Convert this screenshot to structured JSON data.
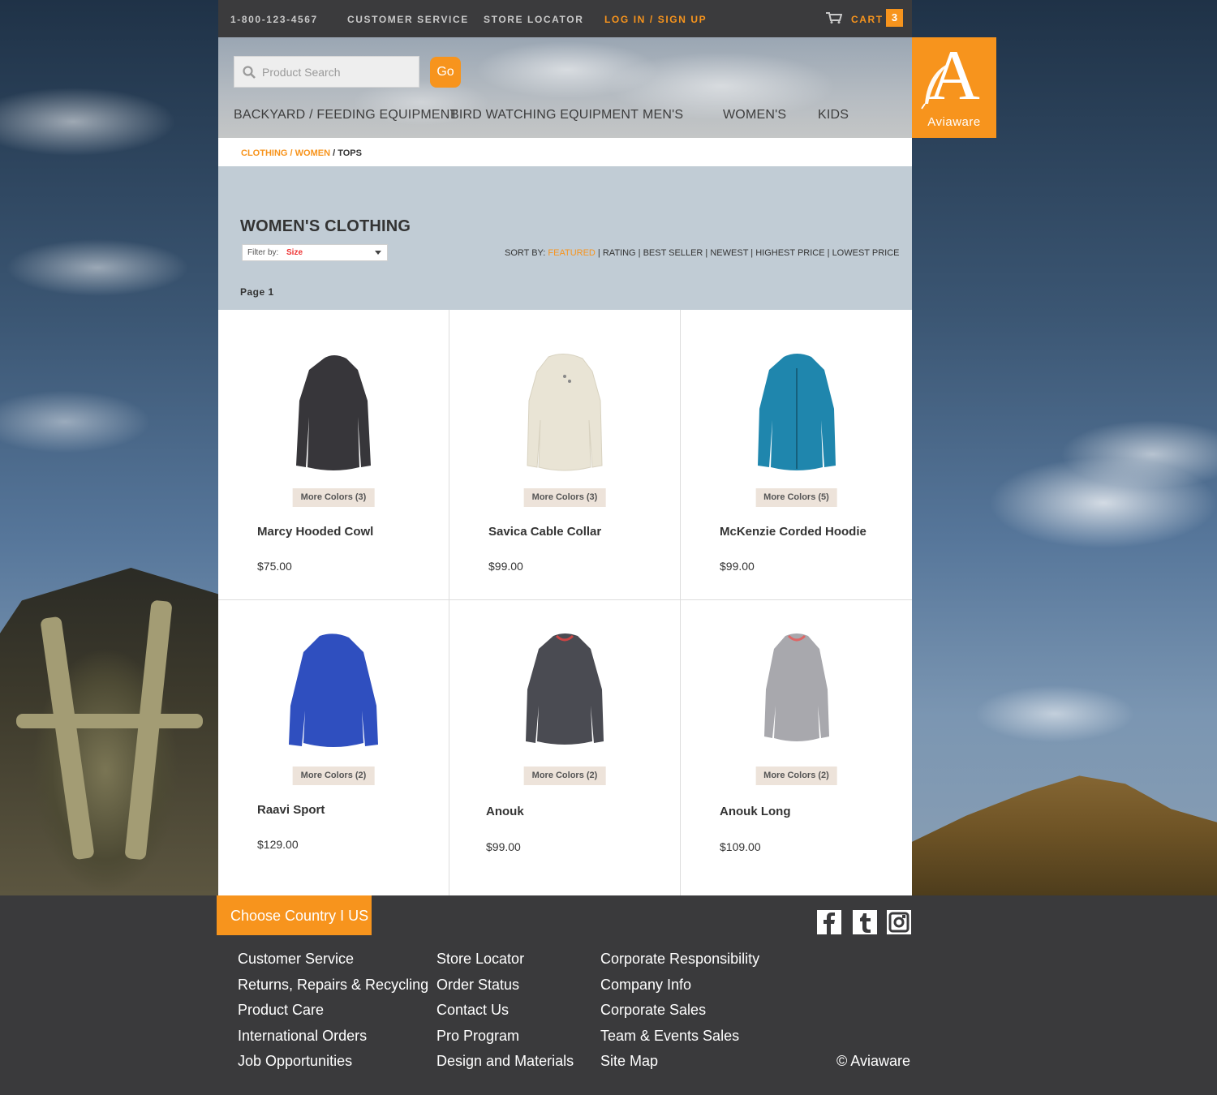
{
  "topbar": {
    "phone": "1-800-123-4567",
    "customer_service": "CUSTOMER SERVICE",
    "store_locator": "STORE LOCATOR",
    "login": "LOG IN / SIGN UP",
    "cart_label": "CART",
    "cart_count": "3",
    "cart_icon": "cart-icon"
  },
  "search": {
    "placeholder": "Product Search",
    "go_label": "Go",
    "icon": "search-icon"
  },
  "nav": {
    "items": [
      "BACKYARD / FEEDING EQUIPMENT",
      "BIRD WATCHING EQUIPMENT",
      "MEN'S",
      "WOMEN'S",
      "KIDS"
    ]
  },
  "logo": {
    "letter": "A",
    "brand": "Aviaware"
  },
  "breadcrumb": {
    "level1": "CLOTHING",
    "level2": "WOMEN",
    "current": "TOPS",
    "sep": " / "
  },
  "listing": {
    "title": "WOMEN'S CLOTHING",
    "filter_label": "Filter by:",
    "filter_value": "Size",
    "sort_label": "SORT BY:",
    "sort_active": "FEATURED",
    "sort_options": [
      "RATING",
      "BEST SELLER",
      "NEWEST",
      "HIGHEST PRICE",
      "LOWEST PRICE"
    ],
    "page_label": "Page 1"
  },
  "products": [
    {
      "name": "Marcy Hooded Cowl",
      "price": "$75.00",
      "more_colors": "More Colors (3)",
      "color": "#37363a"
    },
    {
      "name": "Savica Cable Collar",
      "price": "$99.00",
      "more_colors": "More Colors (3)",
      "color": "#e9e4d5"
    },
    {
      "name": "McKenzie Corded Hoodie",
      "price": "$99.00",
      "more_colors": "More Colors (5)",
      "color": "#1f86ad"
    },
    {
      "name": "Raavi Sport",
      "price": "$129.00",
      "more_colors": "More Colors (2)",
      "color": "#2f4fbf"
    },
    {
      "name": "Anouk",
      "price": "$99.00",
      "more_colors": "More Colors (2)",
      "color": "#4a4b52"
    },
    {
      "name": "Anouk Long",
      "price": "$109.00",
      "more_colors": "More Colors (2)",
      "color": "#a8a8ad"
    }
  ],
  "footer": {
    "country": "Choose Country I US",
    "social_icons": [
      "facebook-icon",
      "tumblr-icon",
      "instagram-icon"
    ],
    "col1": [
      "Customer Service",
      "Returns, Repairs & Recycling",
      "Product Care",
      "International Orders",
      "Job Opportunities"
    ],
    "col2": [
      "Store Locator",
      "Order Status",
      "Contact Us",
      "Pro Program",
      "Design and Materials"
    ],
    "col3": [
      "Corporate Responsibility",
      "Company Info",
      "Corporate Sales",
      "Team & Events Sales",
      "Site Map"
    ],
    "copyright": "© Aviaware"
  },
  "colors": {
    "accent": "#f7941d",
    "dark": "#3b3b3d",
    "listing_bg": "#c1ccd5"
  }
}
